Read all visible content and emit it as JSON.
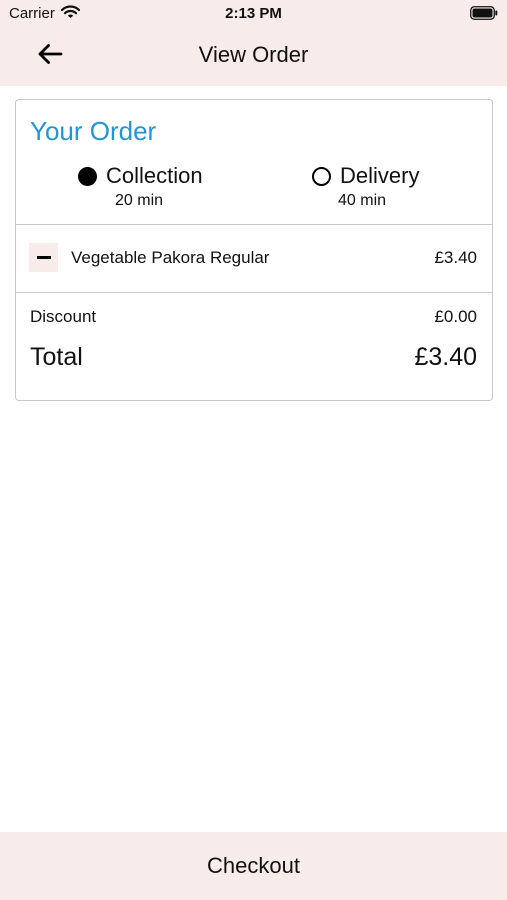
{
  "status_bar": {
    "carrier": "Carrier",
    "time": "2:13 PM"
  },
  "nav": {
    "title": "View Order",
    "back_icon": "arrow-left-icon"
  },
  "order": {
    "title": "Your Order",
    "accent_color": "#2196d6",
    "fulfillment_options": [
      {
        "label": "Collection",
        "time": "20 min",
        "selected": true
      },
      {
        "label": "Delivery",
        "time": "40 min",
        "selected": false
      }
    ],
    "items": [
      {
        "name": "Vegetable Pakora Regular",
        "price": "£3.40"
      }
    ],
    "discount": {
      "label": "Discount",
      "value": "£0.00"
    },
    "total": {
      "label": "Total",
      "value": "£3.40"
    }
  },
  "checkout": {
    "label": "Checkout"
  },
  "colors": {
    "bar_background": "#f7ecea",
    "card_border": "#c8c8c8"
  }
}
